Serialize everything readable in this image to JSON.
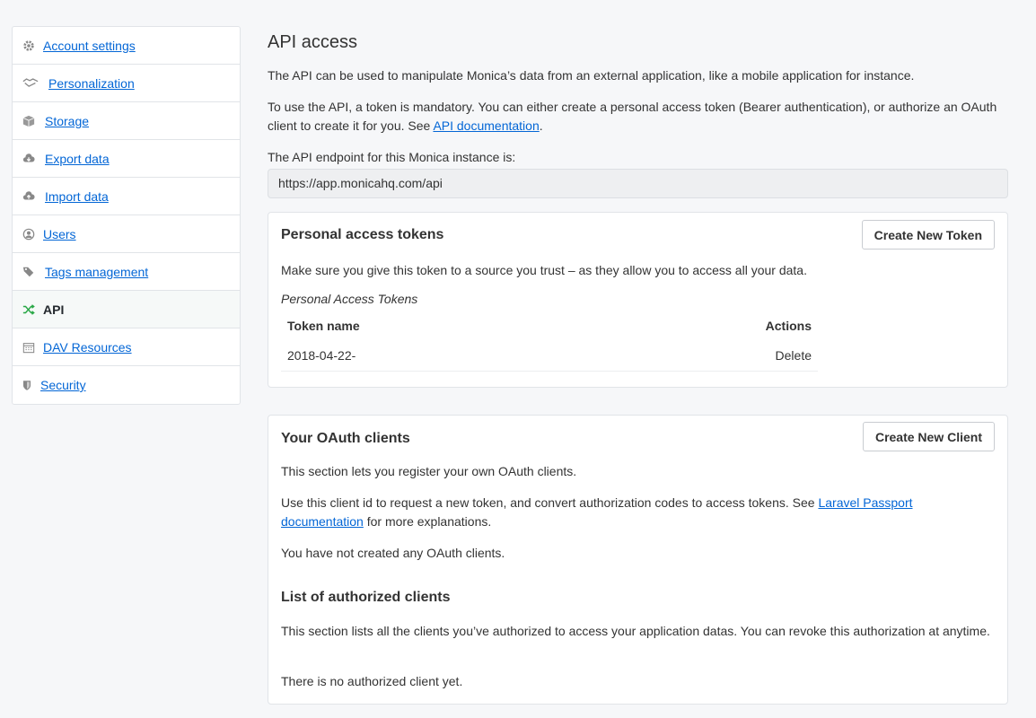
{
  "sidebar": {
    "items": [
      {
        "label": "Account settings",
        "icon": "gear-icon"
      },
      {
        "label": "Personalization",
        "icon": "handshake-icon"
      },
      {
        "label": "Storage",
        "icon": "box-icon"
      },
      {
        "label": "Export data",
        "icon": "cloud-download-icon"
      },
      {
        "label": "Import data",
        "icon": "cloud-upload-icon"
      },
      {
        "label": "Users",
        "icon": "user-circle-icon"
      },
      {
        "label": "Tags management",
        "icon": "tags-icon"
      },
      {
        "label": "API",
        "icon": "random-icon",
        "active": true
      },
      {
        "label": "DAV Resources",
        "icon": "calendar-icon"
      },
      {
        "label": "Security",
        "icon": "shield-icon"
      }
    ]
  },
  "main": {
    "title": "API access",
    "intro": "The API can be used to manipulate Monica’s data from an external application, like a mobile application for instance.",
    "token_text": "To use the API, a token is mandatory. You can either create a personal access token (Bearer authentication), or authorize an OAuth client to create it for you. See ",
    "api_doc_link": "API documentation",
    "period": ".",
    "endpoint_label": "The API endpoint for this Monica instance is:",
    "endpoint_value": "https://app.monicahq.com/api"
  },
  "tokens": {
    "title": "Personal access tokens",
    "create_button": "Create New Token",
    "description": "Make sure you give this token to a source you trust – as they allow you to access all your data.",
    "caption": "Personal Access Tokens",
    "columns": {
      "name": "Token name",
      "actions": "Actions"
    },
    "rows": [
      {
        "name": "2018-04-22-",
        "action": "Delete"
      }
    ]
  },
  "clients": {
    "title": "Your OAuth clients",
    "create_button": "Create New Client",
    "description": "This section lets you register your own OAuth clients.",
    "usage_text": "Use this client id to request a new token, and convert authorization codes to access tokens. See ",
    "passport_link": "Laravel Passport documentation",
    "usage_suffix": " for more explanations.",
    "empty": "You have not created any OAuth clients.",
    "authorized_title": "List of authorized clients",
    "authorized_description": "This section lists all the clients you’ve authorized to access your application datas. You can revoke this authorization at anytime.",
    "authorized_empty": "There is no authorized client yet."
  },
  "colors": {
    "link": "#0366d6",
    "active_icon": "#28a745"
  }
}
